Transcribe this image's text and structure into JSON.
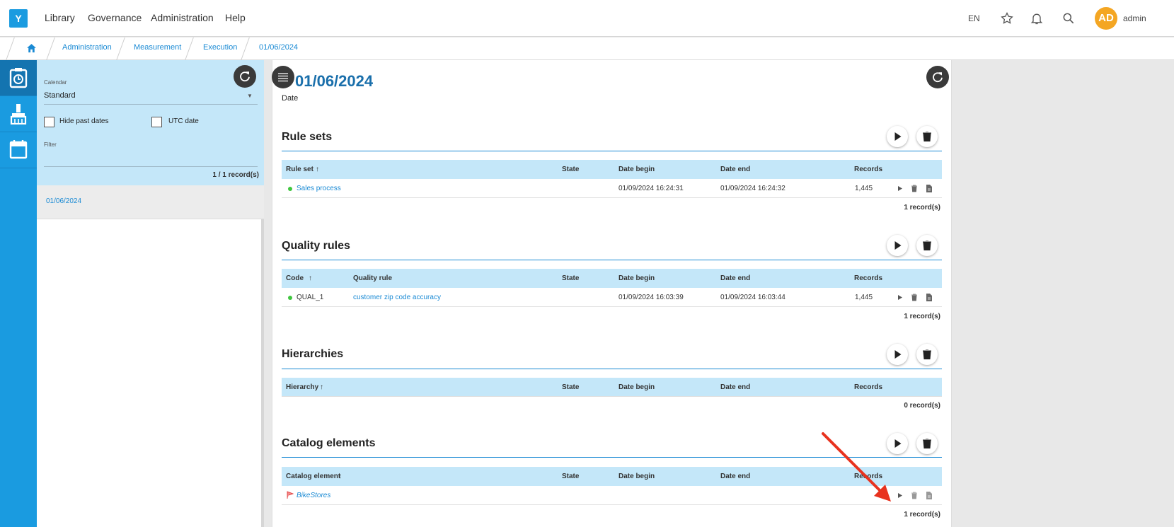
{
  "app": {
    "logo": "Y"
  },
  "nav": {
    "items": [
      "Library",
      "Governance",
      "Administration",
      "Help"
    ]
  },
  "topbar": {
    "language": "EN",
    "avatar_initials": "AD",
    "username": "admin"
  },
  "breadcrumb": {
    "items": [
      "Administration",
      "Measurement",
      "Execution",
      "01/06/2024"
    ]
  },
  "left_panel": {
    "calendar_label": "Calendar",
    "calendar_value": "Standard",
    "hide_past_dates_label": "Hide past dates",
    "utc_date_label": "UTC date",
    "filter_label": "Filter",
    "record_count": "1 / 1 record(s)",
    "items": [
      "01/06/2024"
    ]
  },
  "main": {
    "title": "01/06/2024",
    "subtitle": "Date",
    "sections": {
      "rule_sets": {
        "title": "Rule sets",
        "headers": [
          "Rule set",
          "State",
          "Date begin",
          "Date end",
          "Records"
        ],
        "rows": [
          {
            "name": "Sales process",
            "state": "",
            "date_begin": "01/09/2024 16:24:31",
            "date_end": "01/09/2024 16:24:32",
            "records": "1,445"
          }
        ],
        "count": "1 record(s)"
      },
      "quality_rules": {
        "title": "Quality rules",
        "headers": [
          "Code",
          "Quality rule",
          "State",
          "Date begin",
          "Date end",
          "Records"
        ],
        "rows": [
          {
            "code": "QUAL_1",
            "rule": "customer zip code accuracy",
            "state": "",
            "date_begin": "01/09/2024 16:03:39",
            "date_end": "01/09/2024 16:03:44",
            "records": "1,445"
          }
        ],
        "count": "1 record(s)"
      },
      "hierarchies": {
        "title": "Hierarchies",
        "headers": [
          "Hierarchy",
          "State",
          "Date begin",
          "Date end",
          "Records"
        ],
        "rows": [],
        "count": "0 record(s)"
      },
      "catalog_elements": {
        "title": "Catalog elements",
        "headers": [
          "Catalog element",
          "State",
          "Date begin",
          "Date end",
          "Records"
        ],
        "rows": [
          {
            "name": "BikeStores",
            "state": "",
            "date_begin": "",
            "date_end": "",
            "records": ""
          }
        ],
        "count": "1 record(s)"
      }
    }
  },
  "colors": {
    "accent": "#1a9be0",
    "table_header": "#c4e7f9",
    "status_ok": "#3fc63f",
    "annotation_arrow": "#e8321e"
  }
}
